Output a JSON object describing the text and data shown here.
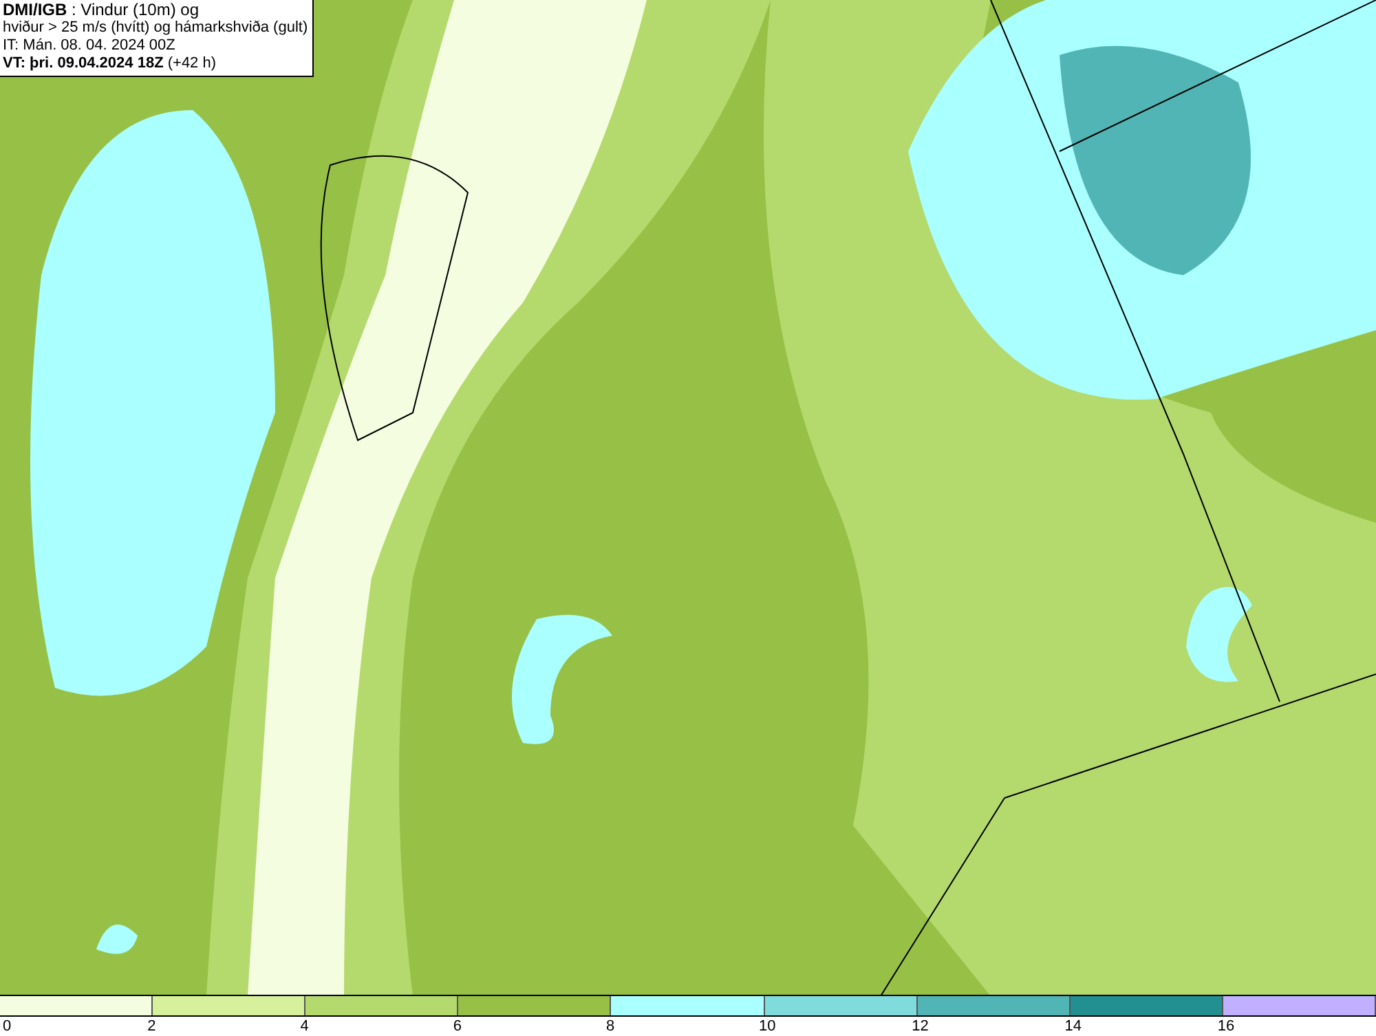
{
  "map": {
    "info_lines": [
      "**DMI/IGB** : Vindur (10m) og",
      "hviður > 25 m/s (hvítt) og hámarkshviða (gult)",
      "IT: Mán. 08. 04. 2024 00Z",
      "**VT: þri. 09.04.2024 18Z** (+42 h)"
    ]
  },
  "legend": [
    {
      "label": "0",
      "color": "#f5fde0"
    },
    {
      "label": "2",
      "color": "#d6f09c"
    },
    {
      "label": "4",
      "color": "#b4da6e"
    },
    {
      "label": "6",
      "color": "#97c146"
    },
    {
      "label": "8",
      "color": "#aaffff"
    },
    {
      "label": "10",
      "color": "#80dcdc"
    },
    {
      "label": "12",
      "color": "#52b5b5"
    },
    {
      "label": "14",
      "color": "#229090"
    },
    {
      "label": "16",
      "color": "#c0b0ff"
    }
  ]
}
